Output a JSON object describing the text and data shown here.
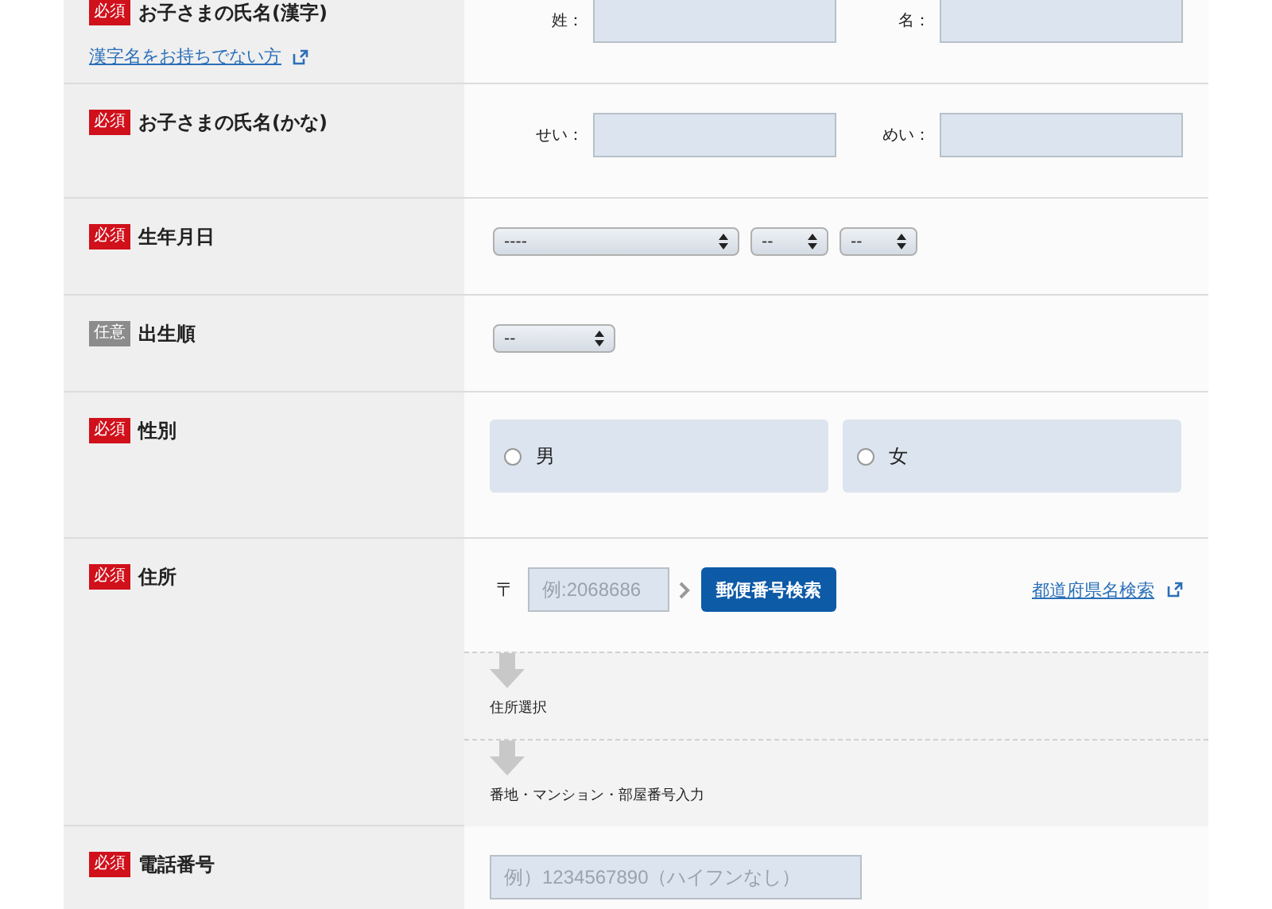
{
  "rows": [
    {
      "kind": "name_pair",
      "badge": {
        "kind": "required",
        "text": "必須"
      },
      "label": "お子さまの氏名(漢字)",
      "link": "漢字名をお持ちでない方",
      "fields": [
        {
          "label": "姓："
        },
        {
          "label": "名："
        }
      ]
    },
    {
      "kind": "name_pair",
      "badge": {
        "kind": "required",
        "text": "必須"
      },
      "label": "お子さまの氏名(かな)",
      "fields": [
        {
          "label": "せい："
        },
        {
          "label": "めい："
        }
      ]
    },
    {
      "kind": "selects",
      "badge": {
        "kind": "required",
        "text": "必須"
      },
      "label": "生年月日",
      "selects": [
        {
          "kind": "year",
          "value": "----"
        },
        {
          "kind": "short",
          "value": "--"
        },
        {
          "kind": "short",
          "value": "--"
        }
      ]
    },
    {
      "kind": "selects",
      "badge": {
        "kind": "optional",
        "text": "任意"
      },
      "label": "出生順",
      "selects": [
        {
          "kind": "medium",
          "value": "--"
        }
      ]
    },
    {
      "kind": "radio",
      "badge": {
        "kind": "required",
        "text": "必須"
      },
      "label": "性別",
      "options": [
        {
          "label": "男",
          "selected": false
        },
        {
          "label": "女",
          "selected": false
        }
      ]
    },
    {
      "kind": "address",
      "badge": {
        "kind": "required",
        "text": "必須"
      },
      "label": "住所",
      "postal_mark": "〒",
      "postal_placeholder": "例:2068686",
      "search_button": "郵便番号検索",
      "pref_link": "都道府県名検索",
      "steps": [
        "住所選択",
        "番地・マンション・部屋番号入力"
      ]
    },
    {
      "kind": "text",
      "badge": {
        "kind": "required",
        "text": "必須"
      },
      "label": "電話番号",
      "placeholder": "例）1234567890（ハイフンなし）"
    }
  ]
}
